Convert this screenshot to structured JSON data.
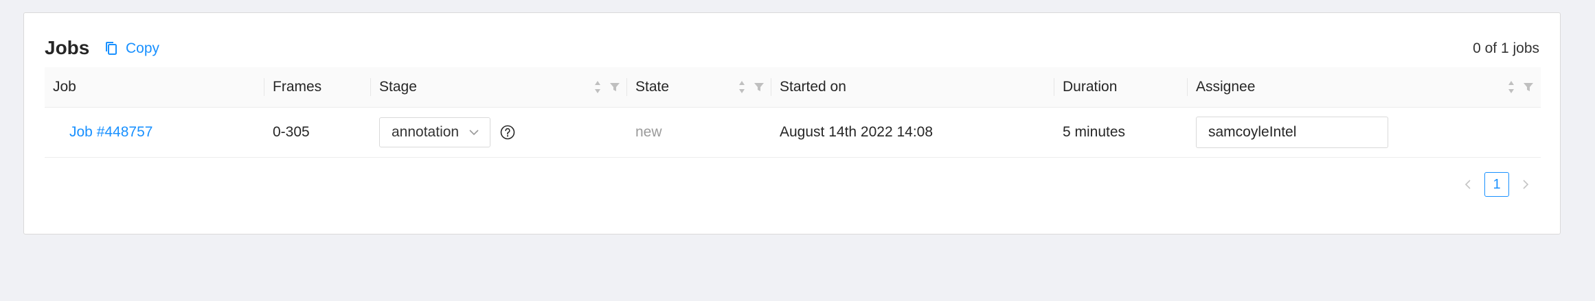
{
  "header": {
    "title": "Jobs",
    "copy_label": "Copy",
    "count_text": "0 of 1 jobs"
  },
  "table": {
    "columns": {
      "job": "Job",
      "frames": "Frames",
      "stage": "Stage",
      "state": "State",
      "started_on": "Started on",
      "duration": "Duration",
      "assignee": "Assignee"
    },
    "rows": [
      {
        "job": "Job #448757",
        "frames": "0-305",
        "stage": "annotation",
        "state": "new",
        "started_on": "August 14th 2022 14:08",
        "duration": "5 minutes",
        "assignee": "samcoyleIntel"
      }
    ]
  },
  "pagination": {
    "current_page": "1"
  },
  "colors": {
    "accent": "#1890ff",
    "background": "#f0f1f5",
    "muted_text": "#9b9b9b"
  },
  "icons": {
    "copy": "copy-icon",
    "sort": "sort-icon",
    "filter": "filter-icon",
    "dropdown": "chevron-down-icon",
    "help": "question-circle-icon",
    "prev": "chevron-left-icon",
    "next": "chevron-right-icon"
  }
}
